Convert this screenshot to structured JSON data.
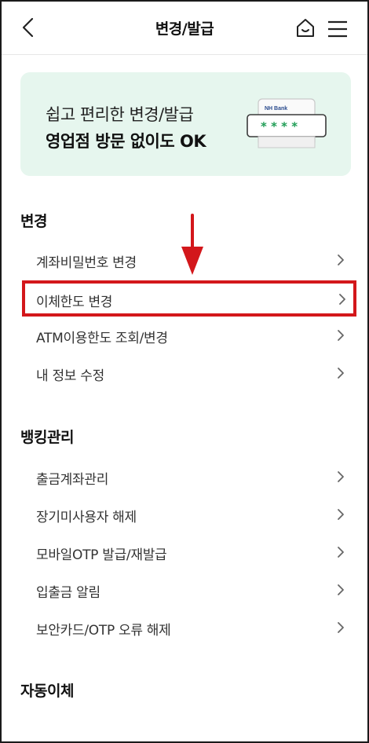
{
  "header": {
    "title": "변경/발급"
  },
  "banner": {
    "line1": "쉽고 편리한 변경/발급",
    "line2": "영업점 방문 없이도 OK",
    "card_brand": "NH Bank",
    "password_mask": "* * * *"
  },
  "sections": {
    "change": {
      "title": "변경",
      "items": [
        "계좌비밀번호 변경",
        "이체한도 변경",
        "ATM이용한도 조회/변경",
        "내 정보 수정"
      ]
    },
    "banking": {
      "title": "뱅킹관리",
      "items": [
        "출금계좌관리",
        "장기미사용자 해제",
        "모바일OTP 발급/재발급",
        "입출금 알림",
        "보안카드/OTP 오류 해제"
      ]
    },
    "autotransfer": {
      "title": "자동이체"
    }
  },
  "colors": {
    "banner_bg": "#e6f6ee",
    "highlight": "#d3171b",
    "accent_green": "#1f9d55"
  }
}
